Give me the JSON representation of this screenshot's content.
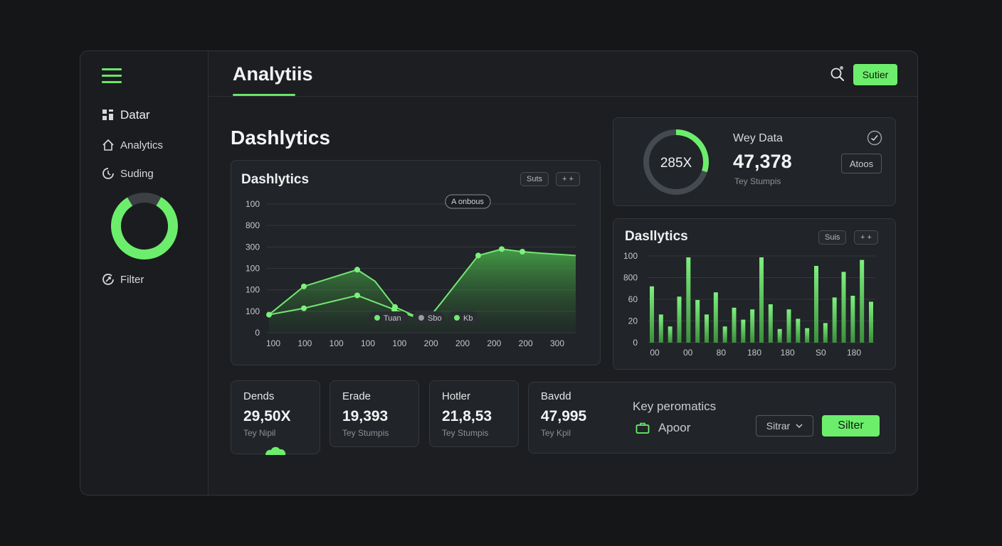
{
  "sidebar": {
    "items": [
      {
        "label": "Datar",
        "icon": "grid-icon"
      },
      {
        "label": "Analytics",
        "icon": "home-icon"
      },
      {
        "label": "Suding",
        "icon": "refresh-icon"
      },
      {
        "label": "Filter",
        "icon": "filter-icon"
      }
    ],
    "donut_progress": 0.83
  },
  "topbar": {
    "title": "Analytiis",
    "button_label": "Sutier"
  },
  "page": {
    "heading": "Dashlytics"
  },
  "line_card": {
    "title": "Dashlytics",
    "chip_label": "Suts",
    "chip2_label": "+ +",
    "tooltip": "A onbous",
    "legend": [
      "Tuan",
      "Sbo",
      "Kb"
    ]
  },
  "summary_card": {
    "ring_label": "285X",
    "ring_progress": 0.3,
    "title": "Wey Data",
    "value": "47,378",
    "sub": "Tey Stumpis",
    "button_label": "Atoos"
  },
  "bar_card": {
    "title": "Dasllytics",
    "chip_label": "Suis",
    "chip2_label": "+ +"
  },
  "stats": [
    {
      "label": "Dends",
      "value": "29,50X",
      "sub": "Tey Nipil"
    },
    {
      "label": "Erade",
      "value": "19,393",
      "sub": "Tey Stumpis"
    },
    {
      "label": "Hotler",
      "value": "21,8,53",
      "sub": "Tey Stumpis"
    }
  ],
  "wide_stat": {
    "label": "Bavdd",
    "value": "47,995",
    "sub": "Tey Kpil",
    "key_title": "Key peromatics",
    "key_item": "Apoor",
    "select_label": "Sitrar",
    "button_label": "Silter"
  },
  "colors": {
    "accent": "#6cee6c",
    "background": "#141618",
    "panel": "#212428"
  },
  "chart_data": [
    {
      "type": "area",
      "title": "Dashlytics",
      "x_tick_labels": [
        "100",
        "100",
        "100",
        "100",
        "100",
        "200",
        "200",
        "200",
        "200",
        "300"
      ],
      "y_tick_labels": [
        "100",
        "800",
        "300",
        "100",
        "100",
        "100",
        "0"
      ],
      "series": [
        {
          "name": "Tuan",
          "values": [
            0.14,
            0.36,
            0.49,
            0.4,
            0.2,
            0.09,
            0.24,
            0.6,
            0.65,
            0.63,
            0.62,
            0.6
          ]
        },
        {
          "name": "Sbo",
          "values": [
            0.14,
            0.19,
            0.29,
            0.18,
            0.09
          ]
        }
      ],
      "grid": true
    },
    {
      "type": "bar",
      "title": "Dasllytics",
      "x_tick_labels": [
        "00",
        "00",
        "80",
        "180",
        "180",
        "S0",
        "180"
      ],
      "y_tick_labels": [
        "100",
        "800",
        "60",
        "20",
        "0"
      ],
      "values": [
        66,
        33,
        19,
        54,
        100,
        50,
        33,
        59,
        19,
        41,
        27,
        39,
        100,
        45,
        16,
        39,
        28,
        17,
        90,
        23,
        53,
        83,
        55,
        97,
        48
      ],
      "ylim": [
        0,
        100
      ],
      "grid": true
    }
  ]
}
